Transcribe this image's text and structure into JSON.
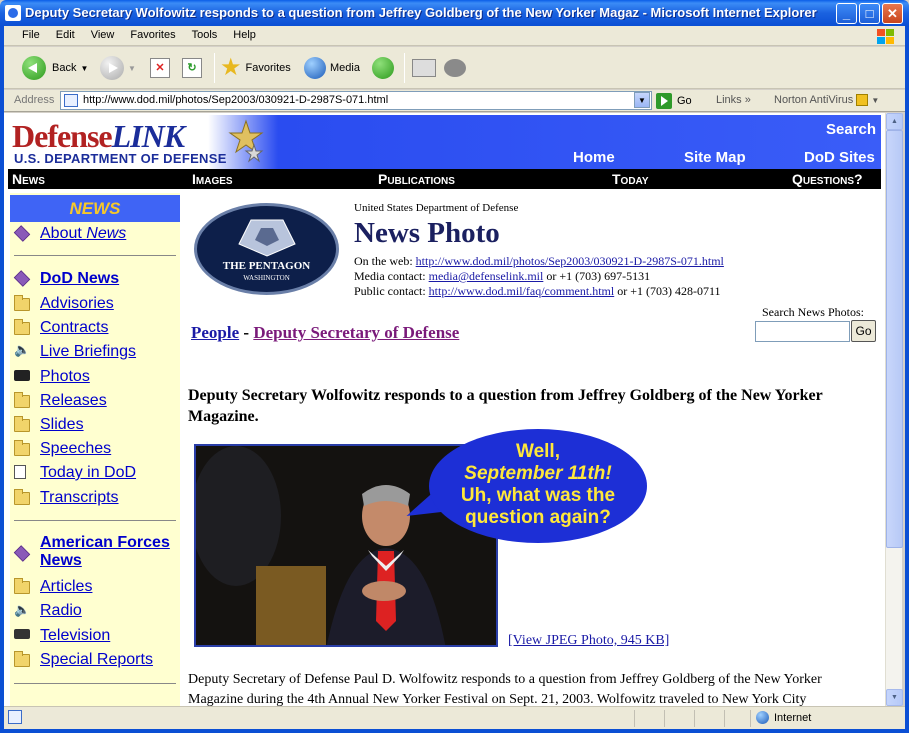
{
  "window": {
    "title": "Deputy Secretary Wolfowitz responds to a question from Jeffrey Goldberg of the New Yorker Magaz - Microsoft Internet Explorer"
  },
  "menu": [
    "File",
    "Edit",
    "View",
    "Favorites",
    "Tools",
    "Help"
  ],
  "toolbar": {
    "back": "Back",
    "favorites": "Favorites",
    "media": "Media"
  },
  "address": {
    "label": "Address",
    "url": "http://www.dod.mil/photos/Sep2003/030921-D-2987S-071.html",
    "go": "Go",
    "links": "Links",
    "chevron": "»",
    "norton": "Norton AntiVirus"
  },
  "site": {
    "logo_main": "Defense",
    "logo_main_italic": "LINK",
    "logo_sub": "U.S. DEPARTMENT OF DEFENSE",
    "search": "Search",
    "home": "Home",
    "sitemap": "Site Map",
    "dodsites": "DoD Sites",
    "nav": [
      "News",
      "Images",
      "Publications",
      "Today",
      "Questions?"
    ]
  },
  "sidebar": {
    "header": "NEWS",
    "about_prefix": "About ",
    "about_italic": "News",
    "items1": [
      "DoD News",
      "Advisories",
      "Contracts",
      "Live Briefings",
      "Photos",
      "Releases",
      "Slides",
      "Speeches",
      "Today in DoD",
      "Transcripts"
    ],
    "afn_line1": "American Forces",
    "afn_line2": "News",
    "items2": [
      "Articles",
      "Radio",
      "Television",
      "Special Reports"
    ]
  },
  "seal": {
    "line1": "THE PENTAGON",
    "line2": "WASHINGTON"
  },
  "page": {
    "org": "United States Department of Defense",
    "title": "News Photo",
    "web_label": "On the web: ",
    "web_url": "http://www.dod.mil/photos/Sep2003/030921-D-2987S-071.html",
    "media_label": "Media contact: ",
    "media_email": "media@defenselink.mil",
    "media_phone": " or +1 (703) 697-5131",
    "public_label": "Public contact: ",
    "public_url": "http://www.dod.mil/faq/comment.html",
    "public_phone": " or +1 (703) 428-0711",
    "search_label": "Search News Photos:",
    "search_go": "Go",
    "crumb_people": "People",
    "crumb_sep": " - ",
    "crumb_depsec": "Deputy Secretary of Defense",
    "headline": "Deputy Secretary Wolfowitz responds to a question from Jeffrey Goldberg of the New Yorker Magazine.",
    "bubble": [
      "Well,",
      "September 11th!",
      "Uh, what was the",
      "question again?"
    ],
    "jpeg_link": "[View JPEG Photo, 945 KB]",
    "caption": "Deputy Secretary of Defense Paul D. Wolfowitz responds to a question from Jeffrey Goldberg of the New Yorker Magazine during the 4th Annual New Yorker Festival on Sept. 21, 2003. Wolfowitz traveled to New York City"
  },
  "status": {
    "zone": "Internet"
  },
  "colors": {
    "titlebar": "#0b4fd4",
    "banner_blue": "#3a5df8",
    "sidebar_bg": "#ffffd0",
    "link": "#0000cc",
    "bubble": "#1d2fd6",
    "bubble_text": "#ffe83a"
  }
}
